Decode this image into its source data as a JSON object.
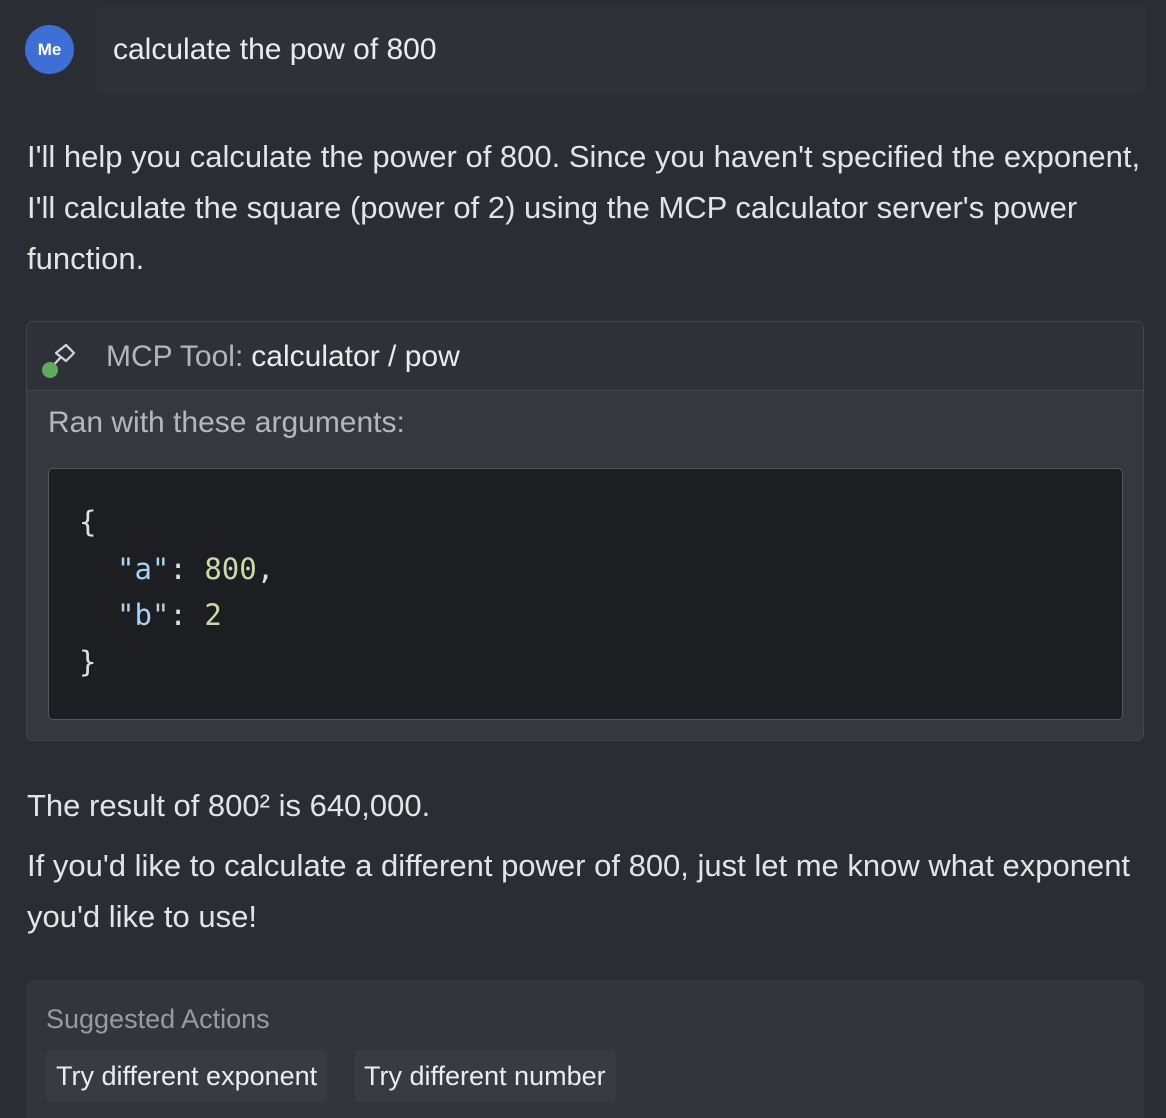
{
  "user": {
    "avatar_label": "Me",
    "message": "calculate the pow of 800"
  },
  "assistant": {
    "intro": "I'll help you calculate the power of 800. Since you haven't specified the exponent, I'll calculate the square (power of 2) using the MCP calculator server's power function.",
    "tool": {
      "prefix": "MCP Tool:",
      "name": "calculator / pow",
      "ran_label": "Ran with these arguments:",
      "code": {
        "open_brace": "{",
        "close_brace": "}",
        "args": [
          {
            "key": "\"a\"",
            "value": "800",
            "sep": ","
          },
          {
            "key": "\"b\"",
            "value": "2",
            "sep": ""
          }
        ]
      }
    },
    "result": "The result of 800² is 640,000.",
    "followup": "If you'd like to calculate a different power of 800, just let me know what exponent you'd like to use!"
  },
  "suggested_actions": {
    "label": "Suggested Actions",
    "items": [
      "Try different exponent",
      "Try different number"
    ]
  },
  "colors": {
    "background": "#2b2d35",
    "avatar": "#3e6fd6",
    "code_background": "#1d1e21",
    "json_key": "#a9d2f0",
    "json_number": "#c7dca6",
    "status_dot": "#5faa5f"
  }
}
